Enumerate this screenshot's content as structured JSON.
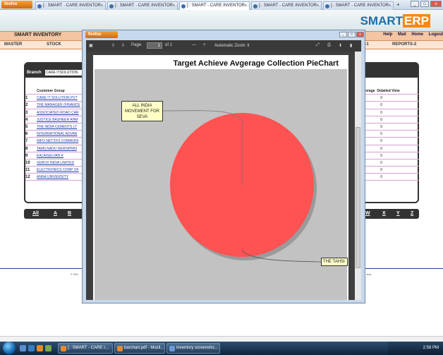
{
  "browser": {
    "menu_button": "firefox",
    "tabs": [
      {
        "title": "[:: SMART - CARE INVENTOR..."
      },
      {
        "title": "[:: SMART - CARE INVENTOR..."
      },
      {
        "title": "[:: SMART - CARE INVENTOR..."
      },
      {
        "title": "[:: SMART - CARE INVENTOR..."
      },
      {
        "title": "[:: SMART - CARE INVENTOR..."
      }
    ],
    "new_tab": "+"
  },
  "app": {
    "logo_smart": "SMART",
    "logo_erp": "ERP",
    "module_title": "SMART INVENTORY",
    "top_links": [
      "Help",
      "Mail",
      "Home",
      "Logout"
    ],
    "menu": [
      "MASTER",
      "STOCK",
      "T-1",
      "REPORTS-2"
    ],
    "branch_label": "Branch",
    "branch_value": "CARE ITSOLUTION",
    "grid_header": "Customer Group",
    "rows": [
      {
        "num": "1",
        "name": "CARE IT SOLUTION PVT"
      },
      {
        "num": "2",
        "name": "THE MANAGER (FINANCE"
      },
      {
        "num": "3",
        "name": "ASSOCIATED ROAD CAR"
      },
      {
        "num": "4",
        "name": "JUSTICE BASHEER AHM"
      },
      {
        "num": "5",
        "name": "THE INDIA CEMENTS LT"
      },
      {
        "num": "6",
        "name": "INTERNATIONAL ADVAN"
      },
      {
        "num": "7",
        "name": "INFO NETSYS COMMUNI"
      },
      {
        "num": "8",
        "name": "TAMILNADU NEWSPRIN"
      },
      {
        "num": "9",
        "name": "KALAISELVAN K"
      },
      {
        "num": "10",
        "name": "XEROX INDIA LIMITED"
      },
      {
        "num": "11",
        "name": "ELECTRONICS CORP OF"
      },
      {
        "num": "12",
        "name": "ANNA UNIVERSITY"
      }
    ],
    "right_headers": [
      "Average",
      "Detailed View"
    ],
    "right_values": [
      "0",
      "0",
      "0",
      "0",
      "0",
      "0",
      "0",
      "0",
      "0",
      "0",
      "0",
      "0"
    ],
    "letters": [
      "All",
      "A",
      "B",
      "W",
      "X",
      "Y",
      "Z"
    ],
    "copyright": "© 200",
    "size_text": "n size."
  },
  "popup": {
    "menu_button": "firefox",
    "pdf_toolbar": {
      "page_label": "Page:",
      "page_value": "1",
      "page_total": "of 1",
      "zoom_minus": "—",
      "zoom_plus": "+",
      "zoom_value": "Automatic Zoom"
    }
  },
  "chart_data": {
    "type": "pie",
    "title": "Target Achieve Avgerage Collection PieChart",
    "labels": [
      "ALL INDIA MOVEMENT FOR SEVA",
      "THE TAHSI"
    ],
    "values": [
      100,
      0
    ],
    "colors": [
      "#ff5252",
      "#c2c2c2"
    ],
    "background": "#c2c2c2"
  },
  "taskbar": {
    "items": [
      {
        "label": "[:: SMART - CARE I..."
      },
      {
        "label": "barchart.pdf - Mozil..."
      },
      {
        "label": "inventory screensho..."
      }
    ],
    "clock": "2:58 PM"
  }
}
